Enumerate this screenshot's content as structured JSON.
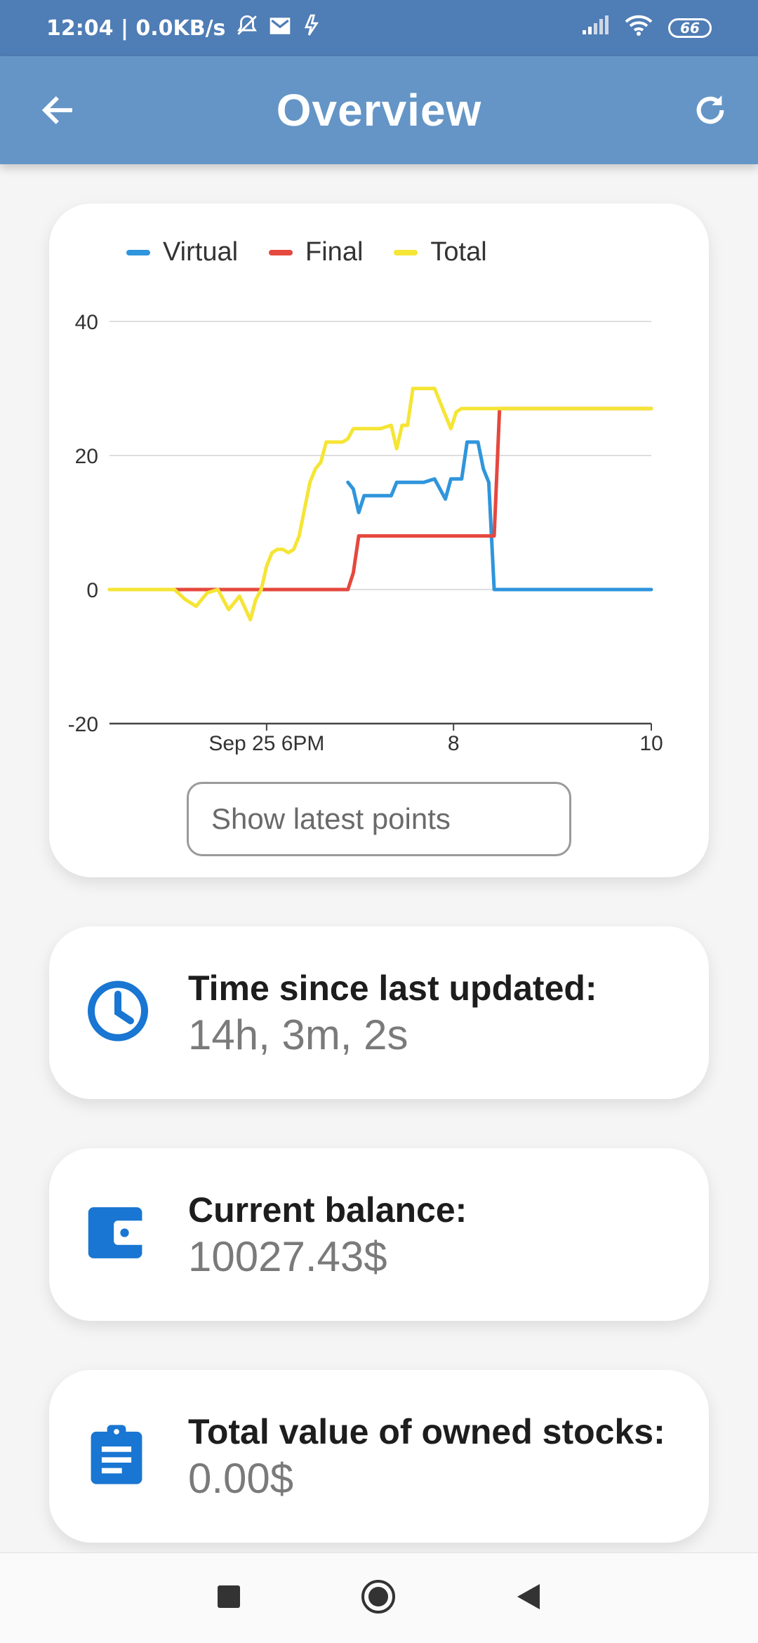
{
  "status_bar": {
    "time_speed": "12:04 | 0.0KB/s",
    "battery": "66",
    "icons": [
      "bell-off-icon",
      "mail-icon",
      "activity-icon",
      "signal-icon",
      "wifi-icon",
      "battery-icon"
    ]
  },
  "app_bar": {
    "title": "Overview",
    "back_icon": "arrow-left-icon",
    "refresh_icon": "refresh-icon",
    "color": "#6495c6"
  },
  "chart_data": {
    "type": "line",
    "legend": [
      "Virtual",
      "Final",
      "Total"
    ],
    "ylim": [
      -20,
      40
    ],
    "yticks": [
      40,
      20,
      0,
      -20
    ],
    "xticks": [
      "Sep 25 6PM",
      "8",
      "10"
    ],
    "xtick_positions": [
      0.29,
      0.635,
      1.0
    ],
    "x": [
      0,
      0.04,
      0.08,
      0.12,
      0.14,
      0.16,
      0.18,
      0.2,
      0.22,
      0.24,
      0.26,
      0.27,
      0.28,
      0.29,
      0.3,
      0.31,
      0.32,
      0.33,
      0.34,
      0.35,
      0.36,
      0.37,
      0.38,
      0.39,
      0.4,
      0.41,
      0.42,
      0.43,
      0.44,
      0.45,
      0.46,
      0.47,
      0.48,
      0.5,
      0.52,
      0.53,
      0.54,
      0.55,
      0.56,
      0.58,
      0.6,
      0.62,
      0.63,
      0.64,
      0.65,
      0.66,
      0.67,
      0.68,
      0.69,
      0.7,
      0.71,
      0.72,
      0.73,
      0.74,
      0.75,
      0.76,
      0.78,
      0.8,
      0.85,
      0.9,
      0.95,
      1.0
    ],
    "series": [
      {
        "name": "Virtual",
        "color": "#2f95dc",
        "values": [
          null,
          null,
          null,
          null,
          null,
          null,
          null,
          null,
          null,
          null,
          null,
          null,
          null,
          null,
          null,
          null,
          null,
          null,
          null,
          null,
          null,
          null,
          null,
          null,
          null,
          null,
          null,
          null,
          16,
          15,
          11.5,
          14,
          14,
          14,
          14,
          16,
          16,
          16,
          16,
          16,
          16.5,
          13.5,
          16.5,
          16.5,
          16.5,
          22,
          22,
          22,
          18,
          16,
          0,
          0,
          0,
          0,
          0,
          0,
          0,
          0,
          0,
          0,
          0,
          0
        ]
      },
      {
        "name": "Final",
        "color": "#e5483e",
        "values": [
          0,
          0,
          0,
          0,
          0,
          0,
          0,
          0,
          0,
          0,
          0,
          0,
          0,
          0,
          0,
          0,
          0,
          0,
          0,
          0,
          0,
          0,
          0,
          0,
          0,
          0,
          0,
          0,
          0,
          2.5,
          8,
          8,
          8,
          8,
          8,
          8,
          8,
          8,
          8,
          8,
          8,
          8,
          8,
          8,
          8,
          8,
          8,
          8,
          8,
          8,
          8,
          27,
          27,
          27,
          27,
          27,
          27,
          27,
          27,
          27,
          27,
          27
        ]
      },
      {
        "name": "Total",
        "color": "#f5e535",
        "values": [
          0,
          0,
          0,
          0,
          -1.5,
          -2.5,
          -0.5,
          0,
          -3,
          -1,
          -4.5,
          -1.5,
          0,
          3.5,
          5.5,
          6,
          6,
          5.5,
          6,
          8,
          12,
          16,
          18,
          19,
          22,
          22,
          22,
          22,
          22.5,
          24,
          24,
          24,
          24,
          24,
          24.5,
          21,
          24.5,
          24.5,
          30,
          30,
          30,
          26,
          24,
          26.5,
          27,
          27,
          27,
          27,
          27,
          27,
          27,
          27,
          27,
          27,
          27,
          27,
          27,
          27,
          27,
          27,
          27,
          27
        ]
      }
    ]
  },
  "show_latest_button": "Show latest points",
  "info_cards": [
    {
      "label": "Time since last updated:",
      "value": "14h, 3m, 2s",
      "icon": "clock-icon"
    },
    {
      "label": "Current balance:",
      "value": "10027.43$",
      "icon": "wallet-icon"
    },
    {
      "label": "Total value of owned stocks:",
      "value": "0.00$",
      "icon": "clipboard-icon"
    }
  ],
  "accent_color": "#1976d2",
  "nav_bar": {
    "icons": [
      "recents-square-icon",
      "home-circle-icon",
      "back-triangle-icon"
    ]
  }
}
